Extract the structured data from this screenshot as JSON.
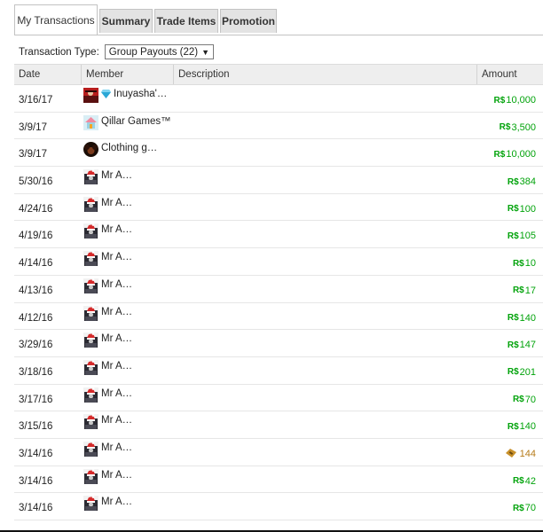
{
  "tabs": [
    {
      "label": "My Transactions",
      "active": true
    },
    {
      "label": "Summary",
      "active": false
    },
    {
      "label": "Trade Items",
      "active": false
    },
    {
      "label": "Promotion",
      "active": false
    }
  ],
  "filter": {
    "label": "Transaction Type:",
    "selected": "Group Payouts (22)"
  },
  "columns": {
    "date": "Date",
    "member": "Member",
    "description": "Description",
    "amount": "Amount"
  },
  "currency_symbol": "R$",
  "colors": {
    "robux_green": "#02a30b",
    "tix_gold": "#b67b1a"
  },
  "rows": [
    {
      "date": "3/16/17",
      "member": "Inuyasha'…",
      "avatar": "red-avatar",
      "badge": "diamond-icon",
      "amount": "10,000",
      "currency": "robux"
    },
    {
      "date": "3/9/17",
      "member": "Qillar Games™",
      "avatar": "house-avatar",
      "amount": "3,500",
      "currency": "robux"
    },
    {
      "date": "3/9/17",
      "member": "Clothing g…",
      "avatar": "afro-avatar",
      "amount": "10,000",
      "currency": "robux"
    },
    {
      "date": "5/30/16",
      "member": "Mr A…",
      "avatar": "santa-avatar",
      "amount": "384",
      "currency": "robux"
    },
    {
      "date": "4/24/16",
      "member": "Mr A…",
      "avatar": "santa-avatar",
      "amount": "100",
      "currency": "robux"
    },
    {
      "date": "4/19/16",
      "member": "Mr A…",
      "avatar": "santa-avatar",
      "amount": "105",
      "currency": "robux"
    },
    {
      "date": "4/14/16",
      "member": "Mr A…",
      "avatar": "santa-avatar",
      "amount": "10",
      "currency": "robux"
    },
    {
      "date": "4/13/16",
      "member": "Mr A…",
      "avatar": "santa-avatar",
      "amount": "17",
      "currency": "robux"
    },
    {
      "date": "4/12/16",
      "member": "Mr A…",
      "avatar": "santa-avatar",
      "amount": "140",
      "currency": "robux"
    },
    {
      "date": "3/29/16",
      "member": "Mr A…",
      "avatar": "santa-avatar",
      "amount": "147",
      "currency": "robux"
    },
    {
      "date": "3/18/16",
      "member": "Mr A…",
      "avatar": "santa-avatar",
      "amount": "201",
      "currency": "robux"
    },
    {
      "date": "3/17/16",
      "member": "Mr A…",
      "avatar": "santa-avatar",
      "amount": "70",
      "currency": "robux"
    },
    {
      "date": "3/15/16",
      "member": "Mr A…",
      "avatar": "santa-avatar",
      "amount": "140",
      "currency": "robux"
    },
    {
      "date": "3/14/16",
      "member": "Mr A…",
      "avatar": "santa-avatar",
      "amount": "144",
      "currency": "tix"
    },
    {
      "date": "3/14/16",
      "member": "Mr A…",
      "avatar": "santa-avatar",
      "amount": "42",
      "currency": "robux"
    },
    {
      "date": "3/14/16",
      "member": "Mr A…",
      "avatar": "santa-avatar",
      "amount": "70",
      "currency": "robux"
    }
  ]
}
